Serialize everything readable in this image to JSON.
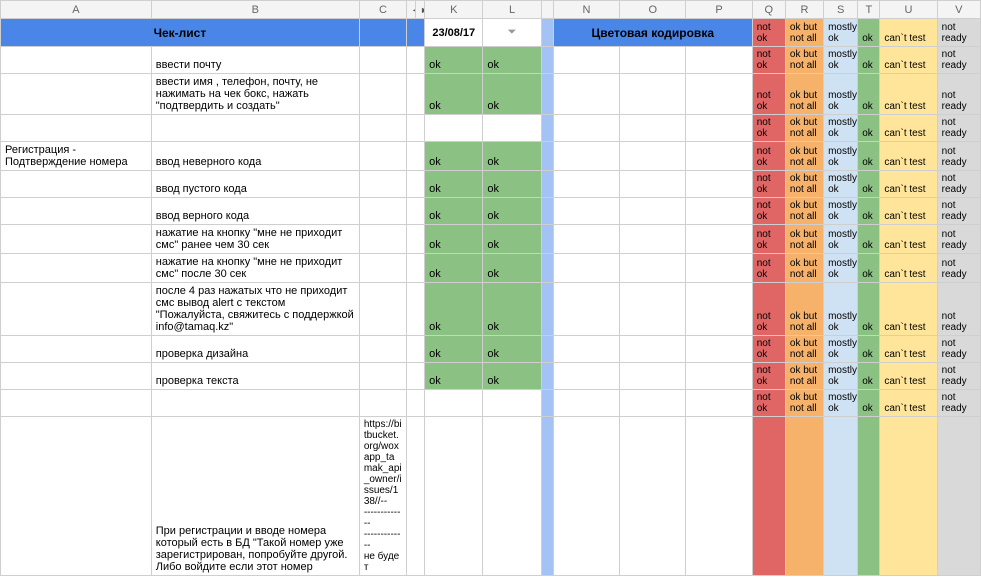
{
  "columns": {
    "A": "A",
    "B": "B",
    "C": "C",
    "J": "",
    "K": "K",
    "L": "L",
    "M": "",
    "N": "N",
    "O": "O",
    "P": "P",
    "Q": "Q",
    "R": "R",
    "S": "S",
    "T": "T",
    "U": "U",
    "V": "V",
    "collapse_left": "◄",
    "collapse_right": "►"
  },
  "headers": {
    "checklist": "Чек-лист",
    "date": "23/08/17",
    "filter_icon": "⏷",
    "coding": "Цветовая кодировка"
  },
  "legend": {
    "q": "not ok",
    "r": "ok but not all",
    "s": "mostly ok",
    "t": "ok",
    "u": "can`t test",
    "v": "not ready"
  },
  "rows": [
    {
      "a": "",
      "b": "ввести почту",
      "k": "ok",
      "l": "ok"
    },
    {
      "a": "",
      "b": "ввести имя , телефон, почту, не нажимать на чек бокс, нажать \"подтвердить и создать\"",
      "k": "ok",
      "l": "ok"
    },
    {
      "a": "",
      "b": "",
      "k": "",
      "l": "",
      "blankKL": true
    },
    {
      "a": "Регистрация - Подтверждение номера",
      "b": "ввод неверного кода",
      "k": "ok",
      "l": "ok"
    },
    {
      "a": "",
      "b": "ввод пустого кода",
      "k": "ok",
      "l": "ok"
    },
    {
      "a": "",
      "b": "ввод верного кода",
      "k": "ok",
      "l": "ok"
    },
    {
      "a": "",
      "b": "нажатие на кнопку \"мне не приходит смс\" ранее чем 30 сек",
      "k": "ok",
      "l": "ok"
    },
    {
      "a": "",
      "b": "нажатие на кнопку \"мне не приходит смс\" после 30 сек",
      "k": "ok",
      "l": "ok"
    },
    {
      "a": "",
      "b": "после 4 раз нажатых что не приходит смс вывод alert с текстом \"Пожалуйста, свяжитесь с поддержкой info@tamaq.kz\"",
      "k": "ok",
      "l": "ok"
    },
    {
      "a": "",
      "b": "проверка дизайна",
      "k": "ok",
      "l": "ok"
    },
    {
      "a": "",
      "b": "проверка текста",
      "k": "ok",
      "l": "ok"
    },
    {
      "a": "",
      "b": "",
      "k": "",
      "l": "",
      "blankKL": true
    }
  ],
  "tall_row": {
    "a": "",
    "b": "При регистрации и вводе номера который есть в БД  \"Такой номер уже зарегистрирован, попробуйте другой. Либо войдите если этот номер",
    "c": "https://bitbucket.org/woxapp_tamak_api_owner/issues/138//--\n-------------\n-------------\nне будет"
  }
}
